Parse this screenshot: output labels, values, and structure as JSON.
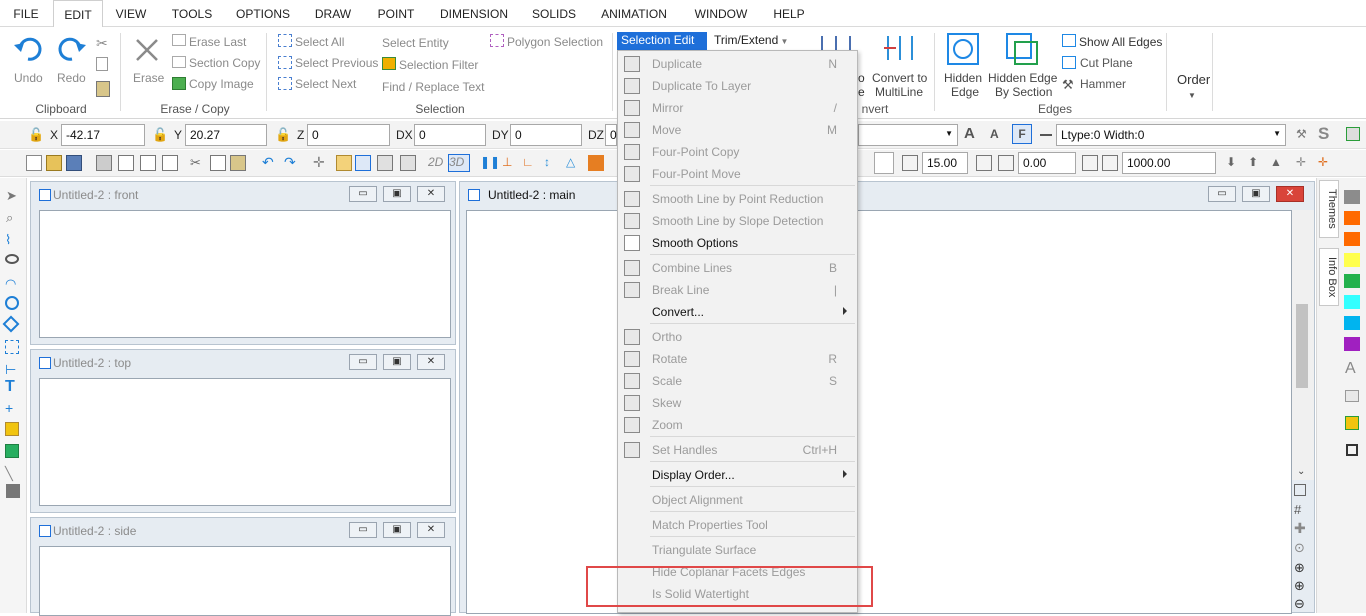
{
  "menubar": {
    "tabs": [
      "FILE",
      "EDIT",
      "VIEW",
      "TOOLS",
      "OPTIONS",
      "DRAW",
      "POINT",
      "DIMENSION",
      "SOLIDS",
      "ANIMATION",
      "WINDOW",
      "HELP"
    ],
    "active": "EDIT"
  },
  "ribbon": {
    "clipboard": {
      "undo": "Undo",
      "redo": "Redo",
      "group": "Clipboard"
    },
    "erase": {
      "erase": "Erase",
      "erase_last": "Erase Last",
      "section_copy": "Section Copy",
      "copy_image": "Copy Image",
      "group": "Erase / Copy"
    },
    "selection": {
      "select_all": "Select All",
      "select_previous": "Select Previous",
      "select_next": "Select Next",
      "select_entity": "Select Entity",
      "selection_filter": "Selection Filter",
      "find_replace": "Find / Replace Text",
      "polygon_selection": "Polygon Selection",
      "group": "Selection"
    },
    "selection_edit": "Selection Edit",
    "trim_extend": "Trim/Extend",
    "convert": {
      "partial_top": "o",
      "partial_bottom": "e",
      "convert_to_multiline_1": "Convert to",
      "convert_to_multiline_2": "MultiLine",
      "group_partial": "nvert"
    },
    "edges": {
      "hidden_edge": "Hidden",
      "hidden_edge_2": "Edge",
      "hidden_by_section_1": "Hidden Edge",
      "hidden_by_section_2": "By Section",
      "show_all_edges": "Show All Edges",
      "cut_plane": "Cut Plane",
      "hammer": "Hammer",
      "group": "Edges"
    },
    "order": "Order"
  },
  "coords": {
    "x_label": "X",
    "x": "-42.17",
    "y_label": "Y",
    "y": "20.27",
    "z_label": "Z",
    "z": "0",
    "dx_label": "DX",
    "dx": "0",
    "dy_label": "DY",
    "dy": "0",
    "dz_label": "DZ",
    "dz": "0",
    "ltype": "Ltype:0  Width:0"
  },
  "toolbar2": {
    "mode_2d": "2D",
    "mode_3d": "3D",
    "value1": "15.00",
    "value2": "0.00",
    "value3": "1000.00"
  },
  "windows": {
    "front": "Untitled-2 : front",
    "top": "Untitled-2 : top",
    "side": "Untitled-2 : side",
    "main": "Untitled-2 : main"
  },
  "right_tabs": {
    "themes": "Themes",
    "info_box": "Info Box"
  },
  "palette_colors": [
    "#8c8c8c",
    "#ff6a00",
    "#ff6a00",
    "#ffff4d",
    "#22b14c",
    "#33ffff",
    "#00b4ef",
    "#a020c0"
  ],
  "dropdown": {
    "items": [
      {
        "label": "Duplicate",
        "shortcut": "N",
        "enabled": false,
        "icon": "duplicate-icon"
      },
      {
        "label": "Duplicate To Layer",
        "shortcut": "",
        "enabled": false,
        "icon": "duplicate-layer-icon"
      },
      {
        "label": "Mirror",
        "shortcut": "/",
        "enabled": false,
        "icon": "mirror-icon"
      },
      {
        "label": "Move",
        "shortcut": "M",
        "enabled": false,
        "icon": "move-icon"
      },
      {
        "label": "Four-Point Copy",
        "shortcut": "",
        "enabled": false,
        "icon": "four-point-copy-icon"
      },
      {
        "label": "Four-Point Move",
        "shortcut": "",
        "enabled": false,
        "icon": "four-point-move-icon"
      },
      {
        "label": "Smooth Line by Point Reduction",
        "shortcut": "",
        "enabled": false,
        "icon": "smooth-point-icon"
      },
      {
        "label": "Smooth Line by Slope Detection",
        "shortcut": "",
        "enabled": false,
        "icon": "smooth-slope-icon"
      },
      {
        "label": "Smooth Options",
        "shortcut": "",
        "enabled": true,
        "icon": "smooth-options-icon"
      },
      {
        "label": "Combine Lines",
        "shortcut": "B",
        "enabled": false,
        "icon": "combine-lines-icon"
      },
      {
        "label": "Break Line",
        "shortcut": "|",
        "enabled": false,
        "icon": "break-line-icon"
      },
      {
        "label": "Convert...",
        "shortcut": "",
        "enabled": true,
        "submenu": true,
        "icon": ""
      },
      {
        "label": "Ortho",
        "shortcut": "",
        "enabled": false,
        "icon": "ortho-icon"
      },
      {
        "label": "Rotate",
        "shortcut": "R",
        "enabled": false,
        "icon": "rotate-icon"
      },
      {
        "label": "Scale",
        "shortcut": "S",
        "enabled": false,
        "icon": "scale-icon"
      },
      {
        "label": "Skew",
        "shortcut": "",
        "enabled": false,
        "icon": "skew-icon"
      },
      {
        "label": "Zoom",
        "shortcut": "",
        "enabled": false,
        "icon": "zoom-icon"
      },
      {
        "label": "Set Handles",
        "shortcut": "Ctrl+H",
        "enabled": false,
        "icon": "set-handles-icon"
      },
      {
        "label": "Display Order...",
        "shortcut": "",
        "enabled": true,
        "submenu": true,
        "icon": ""
      },
      {
        "label": "Object Alignment",
        "shortcut": "",
        "enabled": false,
        "icon": ""
      },
      {
        "label": "Match Properties Tool",
        "shortcut": "",
        "enabled": false,
        "icon": ""
      },
      {
        "label": "Triangulate Surface",
        "shortcut": "",
        "enabled": false,
        "icon": ""
      },
      {
        "label": "Hide Coplanar Facets Edges",
        "shortcut": "",
        "enabled": false,
        "icon": ""
      },
      {
        "label": "Is Solid Watertight",
        "shortcut": "",
        "enabled": false,
        "icon": ""
      }
    ]
  }
}
